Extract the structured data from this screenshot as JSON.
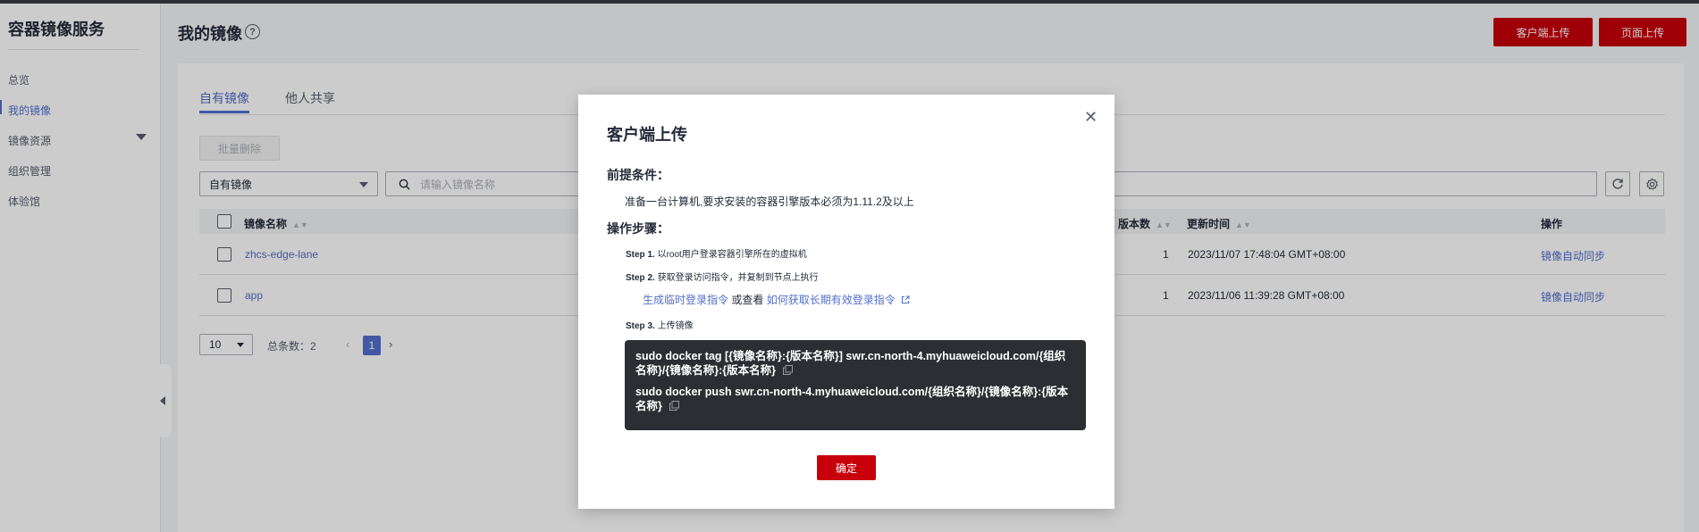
{
  "sidebar": {
    "title": "容器镜像服务",
    "items": [
      {
        "label": "总览"
      },
      {
        "label": "我的镜像"
      },
      {
        "label": "镜像资源"
      },
      {
        "label": "组织管理"
      },
      {
        "label": "体验馆"
      }
    ]
  },
  "header": {
    "title": "我的镜像",
    "help_icon": "?",
    "client_upload": "客户端上传",
    "page_upload": "页面上传"
  },
  "tabs": [
    {
      "label": "自有镜像",
      "active": true
    },
    {
      "label": "他人共享",
      "active": false
    }
  ],
  "toolbar": {
    "batch_delete": "批量删除",
    "filter_value": "自有镜像",
    "search_placeholder": "请输入镜像名称"
  },
  "table": {
    "columns": {
      "name": "镜像名称",
      "versions": "版本数",
      "updated": "更新时间",
      "actions": "操作"
    },
    "rows": [
      {
        "name": "zhcs-edge-lane",
        "versions": "1",
        "updated": "2023/11/07 17:48:04 GMT+08:00",
        "action": "镜像自动同步"
      },
      {
        "name": "app",
        "versions": "1",
        "updated": "2023/11/06 11:39:28 GMT+08:00",
        "action": "镜像自动同步"
      }
    ]
  },
  "pagination": {
    "page_size": "10",
    "total_label": "总条数：2",
    "current_page": "1"
  },
  "modal": {
    "title": "客户端上传",
    "prereq_heading": "前提条件：",
    "prereq_text": "准备一台计算机,要求安装的容器引擎版本必须为1.11.2及以上",
    "steps_heading": "操作步骤：",
    "step1_label": "Step 1.",
    "step1_text": "以root用户登录容器引擎所在的虚拟机",
    "step2_label": "Step 2.",
    "step2_text": "获取登录访问指令，并复制到节点上执行",
    "link_temp": "生成临时登录指令",
    "or_view": "或查看",
    "link_long": "如何获取长期有效登录指令",
    "step3_label": "Step 3.",
    "step3_text": "上传镜像",
    "cmd1": "sudo docker tag [{镜像名称}:{版本名称}] swr.cn-north-4.myhuaweicloud.com/{组织名称}/{镜像名称}:{版本名称}",
    "cmd2": "sudo docker push swr.cn-north-4.myhuaweicloud.com/{组织名称}/{镜像名称}:{版本名称}",
    "ok": "确定"
  },
  "colors": {
    "brand_red": "#c7000b",
    "link_blue": "#526ecc",
    "code_bg": "#2c2e33"
  }
}
